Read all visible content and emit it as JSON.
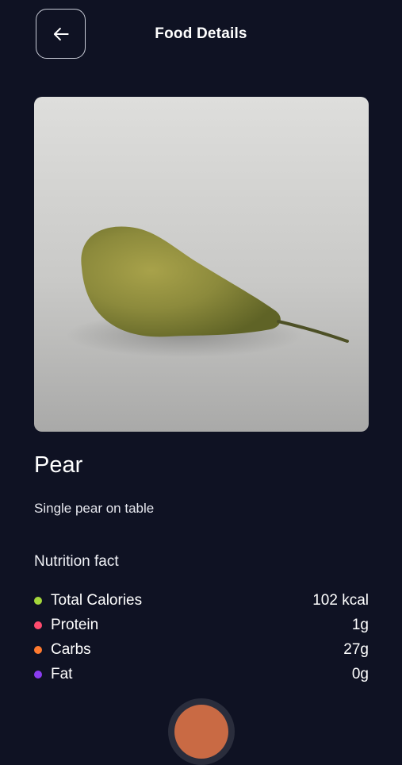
{
  "header": {
    "title": "Food Details",
    "back_icon": "arrow-left-icon"
  },
  "food": {
    "image_alt": "pear photo",
    "name": "Pear",
    "description": "Single pear on table"
  },
  "nutrition": {
    "title": "Nutrition fact",
    "items": [
      {
        "label": "Total Calories",
        "value": "102 kcal",
        "color": "#a4d63b"
      },
      {
        "label": "Protein",
        "value": "1g",
        "color": "#ff4b6e"
      },
      {
        "label": "Carbs",
        "value": "27g",
        "color": "#ff7a2f"
      },
      {
        "label": "Fat",
        "value": "0g",
        "color": "#8a3cf0"
      }
    ]
  },
  "colors": {
    "background": "#0f1223",
    "accent": "#c96a44"
  }
}
